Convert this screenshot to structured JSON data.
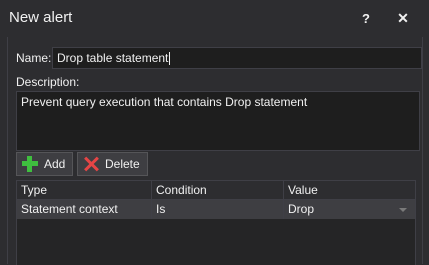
{
  "window": {
    "title": "New alert",
    "help_label": "?",
    "close_label": "✕"
  },
  "form": {
    "name_label": "Name:",
    "name_value": "Drop table statement",
    "description_label": "Description:",
    "description_value": "Prevent query execution that contains Drop statement"
  },
  "toolbar": {
    "add_label": "Add",
    "delete_label": "Delete"
  },
  "grid": {
    "columns": [
      "Type",
      "Condition",
      "Value"
    ],
    "rows": [
      {
        "type": "Statement context",
        "condition": "Is",
        "value": "Drop"
      }
    ]
  },
  "colors": {
    "background": "#2d2d30",
    "input_bg": "#1e1e1e",
    "add_icon": "#3fbf3f",
    "delete_icon": "#e54545"
  }
}
